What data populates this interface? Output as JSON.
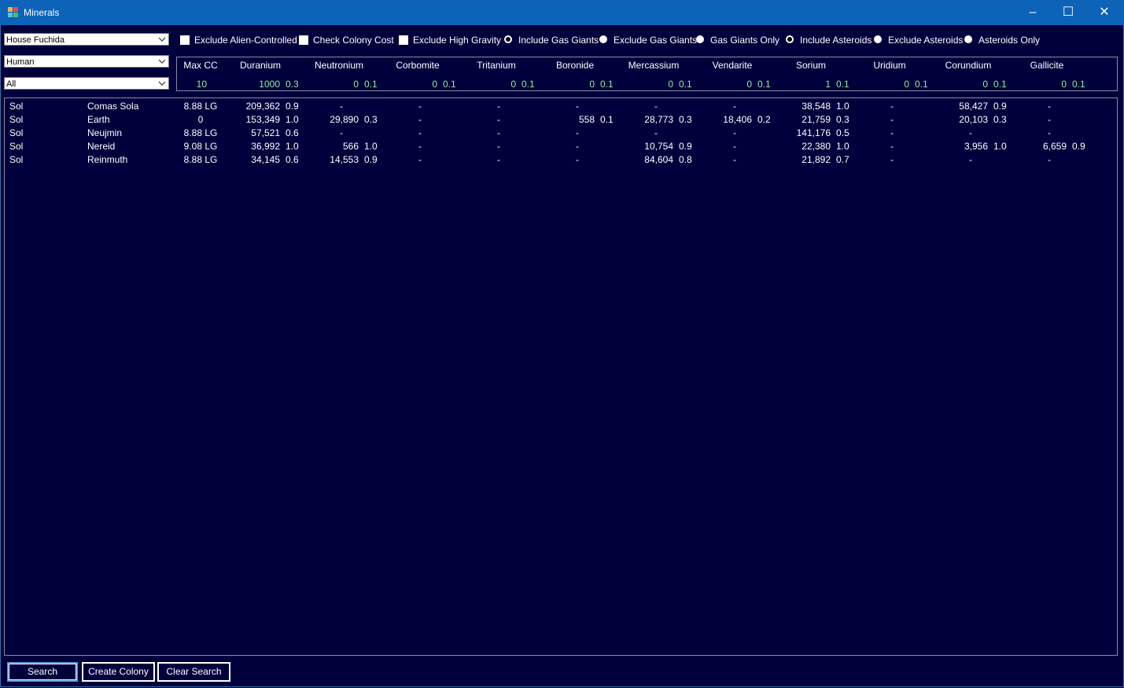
{
  "window": {
    "title": "Minerals"
  },
  "filters": {
    "empire": "House Fuchida",
    "species": "Human",
    "scope": "All"
  },
  "options": [
    {
      "key": "exclude-alien",
      "type": "checkbox",
      "label": "Exclude Alien-Controlled",
      "checked": false
    },
    {
      "key": "check-colony-cost",
      "type": "checkbox",
      "label": "Check Colony Cost",
      "checked": false
    },
    {
      "key": "exclude-high-gravity",
      "type": "checkbox",
      "label": "Exclude High Gravity",
      "checked": false
    },
    {
      "key": "include-gas-giants",
      "type": "radio",
      "label": "Include Gas Giants",
      "checked": true
    },
    {
      "key": "exclude-gas-giants",
      "type": "radio",
      "label": "Exclude Gas Giants",
      "checked": false
    },
    {
      "key": "gas-giants-only",
      "type": "radio",
      "label": "Gas Giants Only",
      "checked": false
    },
    {
      "key": "include-asteroids",
      "type": "radio",
      "label": "Include Asteroids",
      "checked": true
    },
    {
      "key": "exclude-asteroids",
      "type": "radio",
      "label": "Exclude Asteroids",
      "checked": false
    },
    {
      "key": "asteroids-only",
      "type": "radio",
      "label": "Asteroids Only",
      "checked": false
    }
  ],
  "header": {
    "maxcc": {
      "label": "Max CC",
      "value": "10"
    },
    "minerals": [
      {
        "name": "Duranium",
        "amount": "1000",
        "access": "0.3"
      },
      {
        "name": "Neutronium",
        "amount": "0",
        "access": "0.1"
      },
      {
        "name": "Corbomite",
        "amount": "0",
        "access": "0.1"
      },
      {
        "name": "Tritanium",
        "amount": "0",
        "access": "0.1"
      },
      {
        "name": "Boronide",
        "amount": "0",
        "access": "0.1"
      },
      {
        "name": "Mercassium",
        "amount": "0",
        "access": "0.1"
      },
      {
        "name": "Vendarite",
        "amount": "0",
        "access": "0.1"
      },
      {
        "name": "Sorium",
        "amount": "1",
        "access": "0.1"
      },
      {
        "name": "Uridium",
        "amount": "0",
        "access": "0.1"
      },
      {
        "name": "Corundium",
        "amount": "0",
        "access": "0.1"
      },
      {
        "name": "Gallicite",
        "amount": "0",
        "access": "0.1"
      }
    ]
  },
  "rows": [
    {
      "system": "Sol",
      "body": "Comas Sola",
      "cc": "8.88 LG",
      "m": [
        [
          "209,362",
          "0.9"
        ],
        [
          "-",
          ""
        ],
        [
          "-",
          ""
        ],
        [
          "-",
          ""
        ],
        [
          "-",
          ""
        ],
        [
          "-",
          ""
        ],
        [
          "-",
          ""
        ],
        [
          "38,548",
          "1.0"
        ],
        [
          "-",
          ""
        ],
        [
          "58,427",
          "0.9"
        ],
        [
          "-",
          ""
        ]
      ]
    },
    {
      "system": "Sol",
      "body": "Earth",
      "cc": "0",
      "m": [
        [
          "153,349",
          "1.0"
        ],
        [
          "29,890",
          "0.3"
        ],
        [
          "-",
          ""
        ],
        [
          "-",
          ""
        ],
        [
          "558",
          "0.1"
        ],
        [
          "28,773",
          "0.3"
        ],
        [
          "18,406",
          "0.2"
        ],
        [
          "21,759",
          "0.3"
        ],
        [
          "-",
          ""
        ],
        [
          "20,103",
          "0.3"
        ],
        [
          "-",
          ""
        ]
      ]
    },
    {
      "system": "Sol",
      "body": "Neujmin",
      "cc": "8.88 LG",
      "m": [
        [
          "57,521",
          "0.6"
        ],
        [
          "-",
          ""
        ],
        [
          "-",
          ""
        ],
        [
          "-",
          ""
        ],
        [
          "-",
          ""
        ],
        [
          "-",
          ""
        ],
        [
          "-",
          ""
        ],
        [
          "141,176",
          "0.5"
        ],
        [
          "-",
          ""
        ],
        [
          "-",
          ""
        ],
        [
          "-",
          ""
        ]
      ]
    },
    {
      "system": "Sol",
      "body": "Nereid",
      "cc": "9.08 LG",
      "m": [
        [
          "36,992",
          "1.0"
        ],
        [
          "566",
          "1.0"
        ],
        [
          "-",
          ""
        ],
        [
          "-",
          ""
        ],
        [
          "-",
          ""
        ],
        [
          "10,754",
          "0.9"
        ],
        [
          "-",
          ""
        ],
        [
          "22,380",
          "1.0"
        ],
        [
          "-",
          ""
        ],
        [
          "3,956",
          "1.0"
        ],
        [
          "6,659",
          "0.9"
        ]
      ]
    },
    {
      "system": "Sol",
      "body": "Reinmuth",
      "cc": "8.88 LG",
      "m": [
        [
          "34,145",
          "0.6"
        ],
        [
          "14,553",
          "0.9"
        ],
        [
          "-",
          ""
        ],
        [
          "-",
          ""
        ],
        [
          "-",
          ""
        ],
        [
          "84,604",
          "0.8"
        ],
        [
          "-",
          ""
        ],
        [
          "21,892",
          "0.7"
        ],
        [
          "-",
          ""
        ],
        [
          "-",
          ""
        ],
        [
          "-",
          ""
        ]
      ]
    }
  ],
  "buttons": {
    "search": "Search",
    "create_colony": "Create Colony",
    "clear_search": "Clear Search"
  },
  "colors": {
    "titlebar": "#0c63b8",
    "background": "#00003c",
    "header_values": "#90ee90"
  }
}
